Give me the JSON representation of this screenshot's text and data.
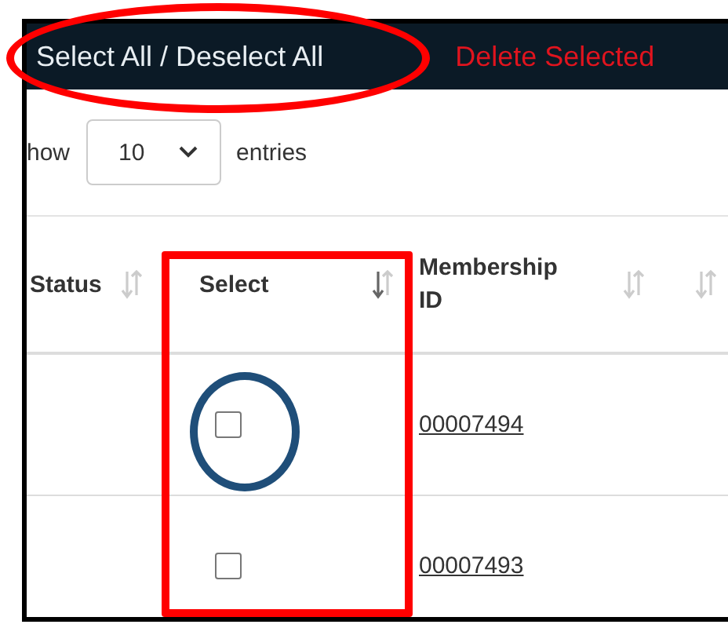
{
  "toolbar": {
    "buttons": [
      {
        "label": "Select All / Deselect All",
        "kind": "plain"
      },
      {
        "label": "Delete Selected",
        "kind": "danger"
      }
    ]
  },
  "length_control": {
    "prefix": "how",
    "value": "10",
    "suffix": "entries"
  },
  "table": {
    "columns": [
      {
        "label": "Status",
        "sorted": false
      },
      {
        "label": "Select",
        "sorted": true
      },
      {
        "label": "Membership ID",
        "sorted": false
      },
      {
        "sorted": false
      }
    ],
    "rows": [
      {
        "checked": false,
        "membership_id": "00007494"
      },
      {
        "checked": false,
        "membership_id": "00007493"
      }
    ]
  },
  "annotations": [
    {
      "kind": "ellipse",
      "color": "#ff0000"
    },
    {
      "kind": "rectangle",
      "color": "#ff0000"
    },
    {
      "kind": "circle",
      "color": "#1f4e79"
    }
  ]
}
